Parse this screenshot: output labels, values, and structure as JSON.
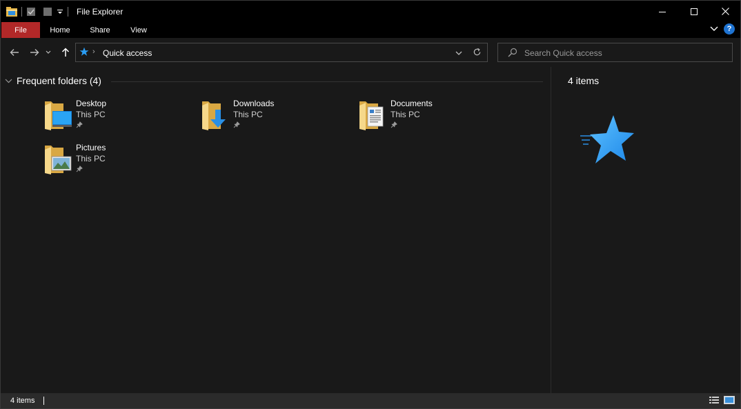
{
  "window": {
    "title": "File Explorer"
  },
  "ribbon": {
    "tabs": [
      {
        "label": "File"
      },
      {
        "label": "Home"
      },
      {
        "label": "Share"
      },
      {
        "label": "View"
      }
    ],
    "help_label": "?"
  },
  "navigation": {
    "breadcrumb": "Quick access",
    "search_placeholder": "Search Quick access"
  },
  "content": {
    "group_header": "Frequent folders (4)",
    "folders": [
      {
        "name": "Desktop",
        "location": "This PC",
        "icon": "desktop-folder-icon"
      },
      {
        "name": "Downloads",
        "location": "This PC",
        "icon": "downloads-folder-icon"
      },
      {
        "name": "Documents",
        "location": "This PC",
        "icon": "documents-folder-icon"
      },
      {
        "name": "Pictures",
        "location": "This PC",
        "icon": "pictures-folder-icon"
      }
    ]
  },
  "preview": {
    "item_count": "4 items"
  },
  "status": {
    "item_count": "4 items"
  },
  "colors": {
    "file_tab": "#b22828",
    "accent_blue": "#1e90ff",
    "folder_yellow": "#f5d27a"
  }
}
